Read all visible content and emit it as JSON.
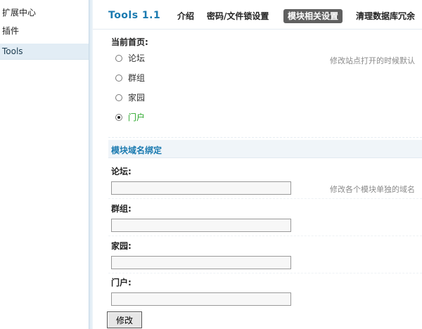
{
  "sidebar": {
    "items": [
      {
        "label": "扩展中心"
      },
      {
        "label": "插件"
      },
      {
        "label": "Tools"
      }
    ]
  },
  "header": {
    "title": "Tools 1.1",
    "tabs": [
      {
        "label": "介绍"
      },
      {
        "label": "密码/文件锁设置"
      },
      {
        "label": "模块相关设置",
        "active": true
      },
      {
        "label": "清理数据库冗余"
      }
    ]
  },
  "home_section": {
    "label": "当前首页:",
    "hint": "修改站点打开的时候默认",
    "options": [
      {
        "label": "论坛",
        "checked": false
      },
      {
        "label": "群组",
        "checked": false
      },
      {
        "label": "家园",
        "checked": false
      },
      {
        "label": "门户",
        "checked": true
      }
    ]
  },
  "domain_section": {
    "title": "模块域名绑定",
    "hint": "修改各个模块单独的域名",
    "fields": [
      {
        "label": "论坛:",
        "value": ""
      },
      {
        "label": "群组:",
        "value": ""
      },
      {
        "label": "家园:",
        "value": ""
      },
      {
        "label": "门户:",
        "value": ""
      }
    ]
  },
  "submit_label": "修改",
  "colors": {
    "accent": "#1a7ab0",
    "active_tab_bg": "#606060",
    "selected_option": "#2aa82a",
    "sidebar_active_bg": "#e2edf5"
  }
}
